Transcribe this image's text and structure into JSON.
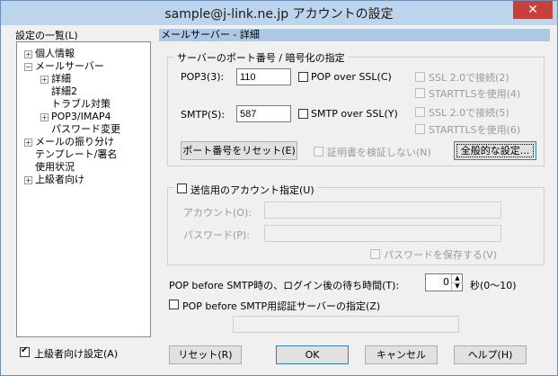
{
  "window": {
    "title": "sample@j-link.ne.jp アカウントの設定",
    "close_glyph": "✕"
  },
  "sidebar": {
    "label": "設定の一覧(L)",
    "tree": [
      {
        "label": "個人情報",
        "expander": "+"
      },
      {
        "label": "メールサーバー",
        "expander": "−"
      },
      {
        "label": "詳細",
        "expander": "+"
      },
      {
        "label": "詳細2"
      },
      {
        "label": "トラブル対策"
      },
      {
        "label": "POP3/IMAP4",
        "expander": "+"
      },
      {
        "label": "パスワード変更"
      },
      {
        "label": "メールの振り分け",
        "expander": "+"
      },
      {
        "label": "テンプレート/署名"
      },
      {
        "label": "使用状況"
      },
      {
        "label": "上級者向け",
        "expander": "+"
      }
    ],
    "advanced_checkbox_label": "上級者向け設定(A)",
    "advanced_checked": true
  },
  "panel": {
    "header": "メールサーバー - 詳細",
    "port_group": {
      "title": "サーバーのポート番号 / 暗号化の指定",
      "pop3_label": "POP3(3):",
      "pop3_value": "110",
      "pop_ssl_label": "POP over SSL(C)",
      "smtp_label": "SMTP(S):",
      "smtp_value": "587",
      "smtp_ssl_label": "SMTP over SSL(Y)",
      "ssl2_pop_label": "SSL 2.0で接続(2)",
      "starttls_pop_label": "STARTTLSを使用(4)",
      "ssl2_smtp_label": "SSL 2.0で接続(5)",
      "starttls_smtp_label": "STARTTLSを使用(6)",
      "reset_port_button": "ポート番号をリセット(E)",
      "no_verify_cert_label": "証明書を検証しない(N)",
      "general_settings_button": "全般的な設定..."
    },
    "send_account": {
      "checkbox_label": "送信用のアカウント指定(U)",
      "account_label": "アカウント(O):",
      "password_label": "パスワード(P):",
      "save_password_label": "パスワードを保存する(V)"
    },
    "wait": {
      "label": "POP before SMTP時の、ログイン後の待ち時間(T):",
      "value": "0",
      "suffix": "秒(0〜10)"
    },
    "auth_server": {
      "checkbox_label": "POP before SMTP用認証サーバーの指定(Z)"
    }
  },
  "buttons": {
    "reset": "リセット(R)",
    "ok": "OK",
    "cancel": "キャンセル",
    "help": "ヘルプ(H)"
  }
}
